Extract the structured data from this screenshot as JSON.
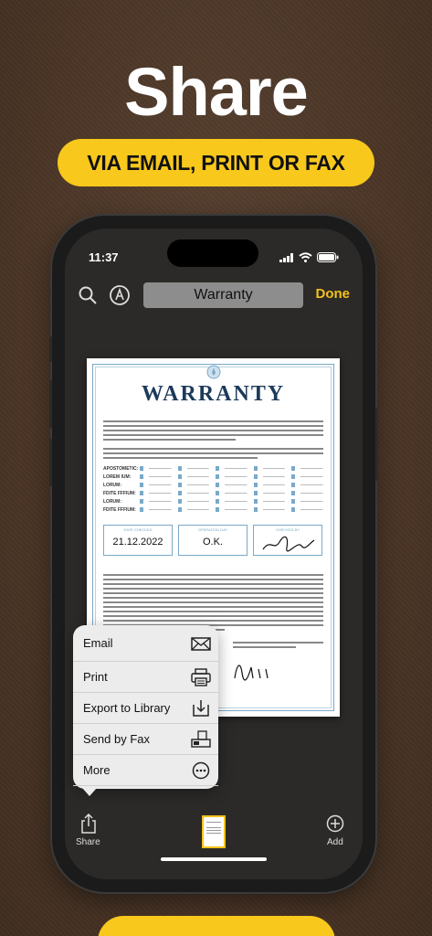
{
  "promo": {
    "headline": "Share",
    "subheadline": "VIA EMAIL, PRINT OR FAX"
  },
  "status_bar": {
    "time": "11:37"
  },
  "top_toolbar": {
    "title": "Warranty",
    "done_label": "Done"
  },
  "document": {
    "title": "WARRANTY",
    "row_labels": [
      "APOSTOMETIC:",
      "LOREM IUM:",
      "LORUM:",
      "FDITE FFFIUM:",
      "LORUM:",
      "FDITE FFFIUM:"
    ],
    "info_boxes": [
      {
        "caption": "DATE CHECKED",
        "value": "21.12.2022"
      },
      {
        "caption": "OPERATION DAY",
        "value": "O.K."
      },
      {
        "caption": "CHECKED BY",
        "value": ""
      }
    ]
  },
  "share_menu": {
    "items": [
      {
        "label": "Email",
        "icon": "envelope-icon"
      },
      {
        "label": "Print",
        "icon": "printer-icon"
      },
      {
        "label": "Export to Library",
        "icon": "download-tray-icon"
      },
      {
        "label": "Send by Fax",
        "icon": "fax-icon"
      },
      {
        "label": "More",
        "icon": "ellipsis-circle-icon"
      }
    ]
  },
  "bottom_toolbar": {
    "share_label": "Share",
    "add_label": "Add"
  },
  "colors": {
    "accent": "#f8c81c",
    "background": "#4a3526",
    "done_text": "#f2c21a",
    "document_blue": "#7aa9c9"
  }
}
